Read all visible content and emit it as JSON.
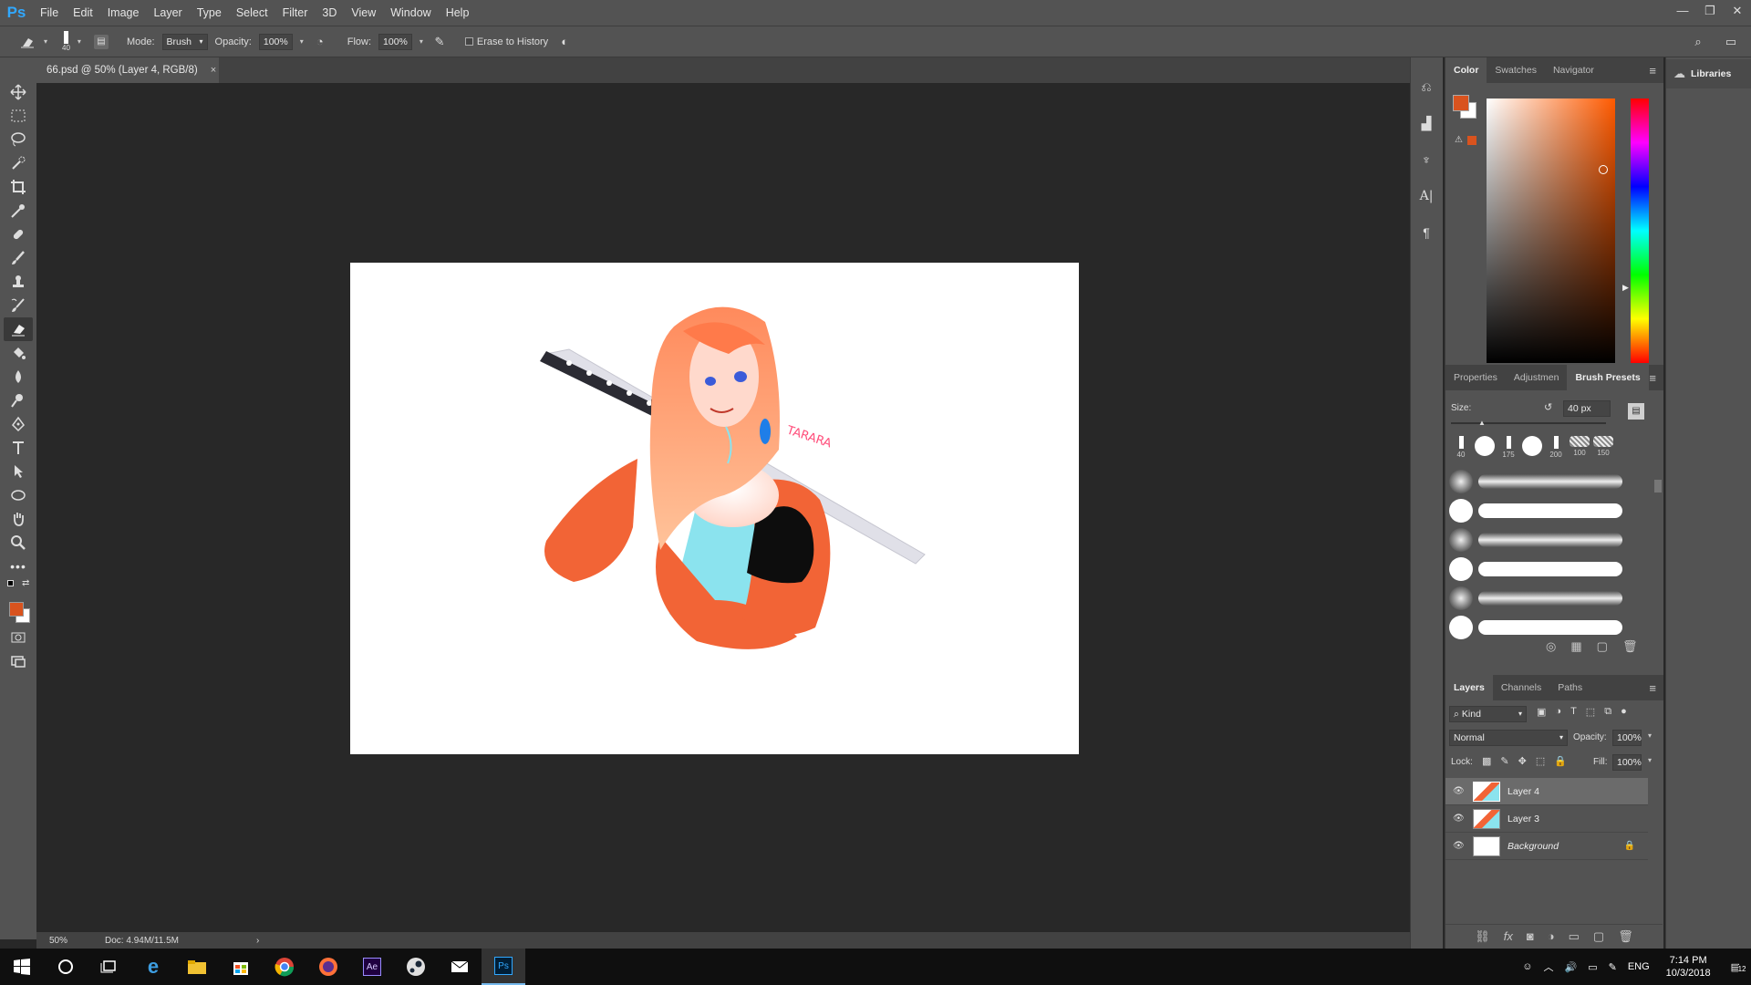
{
  "app": {
    "logo": "Ps",
    "menu": [
      "File",
      "Edit",
      "Image",
      "Layer",
      "Type",
      "Select",
      "Filter",
      "3D",
      "View",
      "Window",
      "Help"
    ]
  },
  "options": {
    "brush_size": "40",
    "mode_label": "Mode:",
    "mode_value": "Brush",
    "opacity_label": "Opacity:",
    "opacity_value": "100%",
    "flow_label": "Flow:",
    "flow_value": "100%",
    "erase_history_label": "Erase to History"
  },
  "document": {
    "tab_title": "66.psd @ 50% (Layer 4, RGB/8)",
    "signature": "TARARA"
  },
  "status": {
    "zoom": "50%",
    "doc": "Doc: 4.94M/11.5M"
  },
  "color_panel": {
    "tabs": [
      "Color",
      "Swatches",
      "Navigator"
    ],
    "foreground": "#d9531e",
    "background": "#ffffff",
    "hue_color": "#ff5a00"
  },
  "brush_panel": {
    "tabs": [
      "Properties",
      "Adjustmen",
      "Brush Presets"
    ],
    "size_label": "Size:",
    "size_value": "40 px",
    "recent_sizes": [
      "40",
      "",
      "175",
      "",
      "200",
      "100",
      "150"
    ]
  },
  "layers_panel": {
    "tabs": [
      "Layers",
      "Channels",
      "Paths"
    ],
    "kind_label": "Kind",
    "blend_mode": "Normal",
    "opacity_label": "Opacity:",
    "opacity_value": "100%",
    "lock_label": "Lock:",
    "fill_label": "Fill:",
    "fill_value": "100%",
    "layers": [
      {
        "name": "Layer 4",
        "selected": true
      },
      {
        "name": "Layer 3",
        "selected": false
      },
      {
        "name": "Background",
        "selected": false,
        "locked": true
      }
    ]
  },
  "libraries": {
    "label": "Libraries"
  },
  "taskbar": {
    "lang": "ENG",
    "time": "7:14 PM",
    "date": "10/3/2018",
    "notifications": "12"
  }
}
